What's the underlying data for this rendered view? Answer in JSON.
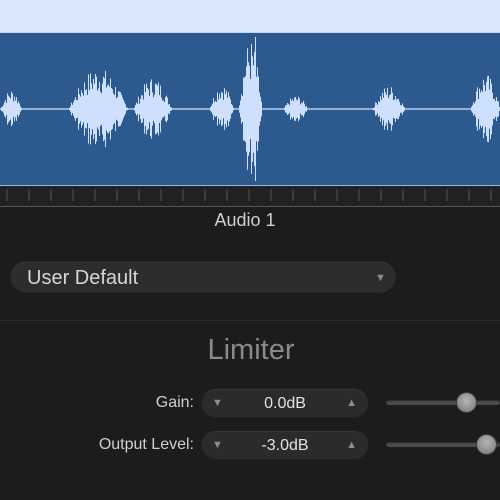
{
  "track": {
    "name": "Audio 1",
    "region_color": "#2c5a8f",
    "waveform_color": "#cfe0ff"
  },
  "preset": {
    "label": "User Default",
    "arrow_icon": "triangle-down"
  },
  "plugin": {
    "title": "Limiter"
  },
  "params": [
    {
      "label": "Gain:",
      "value": "0.0dB",
      "slider_fraction": 0.7
    },
    {
      "label": "Output Level:",
      "value": "-3.0dB",
      "slider_fraction": 0.88
    }
  ]
}
